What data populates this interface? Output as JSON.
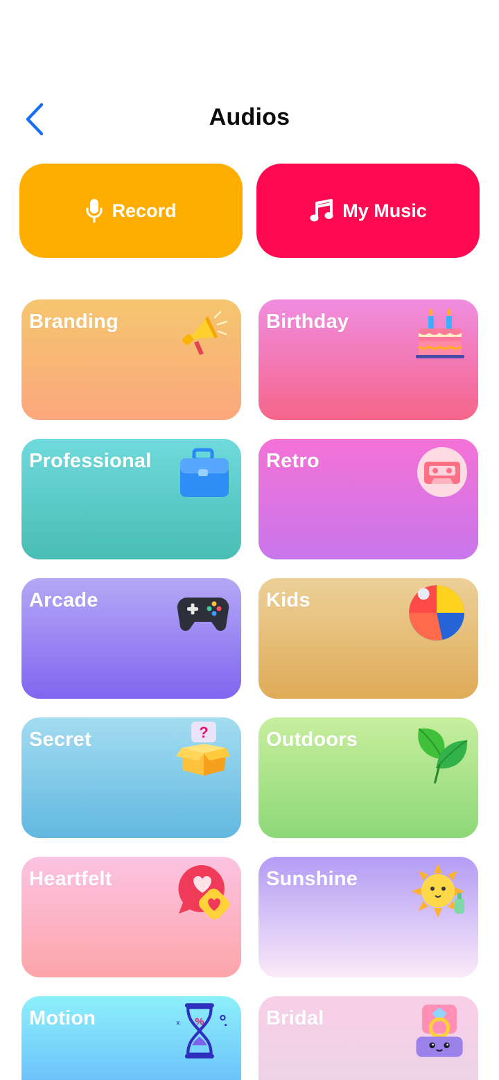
{
  "header": {
    "title": "Audios"
  },
  "actions": {
    "record_label": "Record",
    "music_label": "My Music"
  },
  "categories": [
    {
      "label": "Branding"
    },
    {
      "label": "Birthday"
    },
    {
      "label": "Professional"
    },
    {
      "label": "Retro"
    },
    {
      "label": "Arcade"
    },
    {
      "label": "Kids"
    },
    {
      "label": "Secret"
    },
    {
      "label": "Outdoors"
    },
    {
      "label": "Heartfelt"
    },
    {
      "label": "Sunshine"
    },
    {
      "label": "Motion"
    },
    {
      "label": "Bridal"
    }
  ],
  "icons": {
    "back": "chevron-left-icon",
    "record": "microphone-icon",
    "music": "music-note-icon"
  },
  "colors": {
    "accent": "#1a6ff5",
    "record": "#ffae00",
    "music": "#ff0a50"
  }
}
